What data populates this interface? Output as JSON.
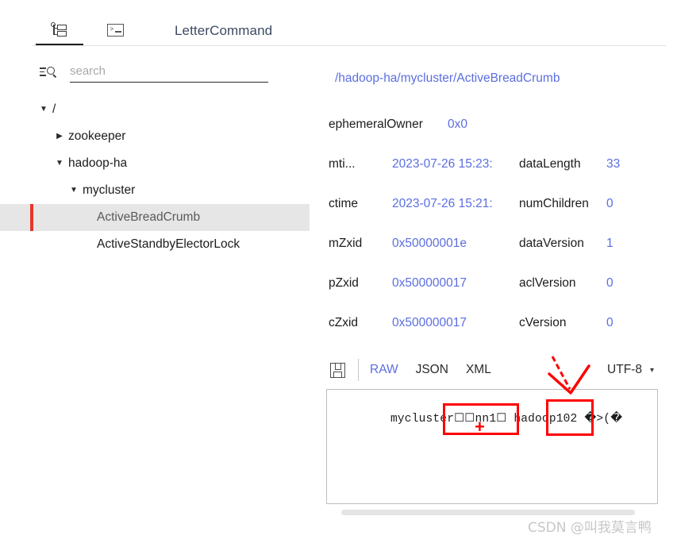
{
  "window": {
    "tabs": [
      {
        "name": "tree-view",
        "icon": "tree-icon",
        "active": true
      },
      {
        "name": "terminal-view",
        "icon": "terminal-icon",
        "active": false
      }
    ],
    "title": "LetterCommand"
  },
  "sidebar": {
    "search": {
      "value": "",
      "placeholder": "search",
      "icon": "search-filter-icon"
    },
    "tree": [
      {
        "label": "/",
        "depth": 0,
        "arrow": "▼",
        "expanded": true,
        "selected": false
      },
      {
        "label": "zookeeper",
        "depth": 1,
        "arrow": "▶",
        "expanded": false,
        "selected": false
      },
      {
        "label": "hadoop-ha",
        "depth": 1,
        "arrow": "▼",
        "expanded": true,
        "selected": false
      },
      {
        "label": "mycluster",
        "depth": 2,
        "arrow": "▼",
        "expanded": true,
        "selected": false
      },
      {
        "label": "ActiveBreadCrumb",
        "depth": 3,
        "arrow": "",
        "expanded": false,
        "selected": true
      },
      {
        "label": "ActiveStandbyElectorLock",
        "depth": 3,
        "arrow": "",
        "expanded": false,
        "selected": false
      }
    ]
  },
  "detail": {
    "node_path": "/hadoop-ha/mycluster/ActiveBreadCrumb",
    "rows": [
      {
        "left_key": "ephemeralOwner",
        "left_value": "0x0",
        "right_key": "",
        "right_value": ""
      },
      {
        "left_key": "mti...",
        "left_value": "2023-07-26 15:23:",
        "right_key": "dataLength",
        "right_value": "33"
      },
      {
        "left_key": "ctime",
        "left_value": "2023-07-26 15:21:",
        "right_key": "numChildren",
        "right_value": "0"
      },
      {
        "left_key": "mZxid",
        "left_value": "0x50000001e",
        "right_key": "dataVersion",
        "right_value": "1"
      },
      {
        "left_key": "pZxid",
        "left_value": "0x500000017",
        "right_key": "aclVersion",
        "right_value": "0"
      },
      {
        "left_key": "cZxid",
        "left_value": "0x500000017",
        "right_key": "cVersion",
        "right_value": "0"
      }
    ]
  },
  "data_toolbar": {
    "save_icon": "save-floppy-icon",
    "formats": [
      {
        "label": "RAW",
        "active": true
      },
      {
        "label": "JSON",
        "active": false
      },
      {
        "label": "XML",
        "active": false
      }
    ],
    "encoding": "UTF-8",
    "encoding_caret": "▾"
  },
  "data_content": {
    "text": "mycluster☐☐nn1☐ hadoop102 �>(�"
  },
  "annotations": {
    "plus_symbol": "+",
    "color": "#ff0000"
  },
  "watermark": "CSDN @叫我莫言鸭",
  "colors": {
    "accent_blue": "#5b6ee1",
    "selection_bar_red": "#e8352b",
    "annotation_red": "#ff0000",
    "title_text": "#3b4a63"
  }
}
